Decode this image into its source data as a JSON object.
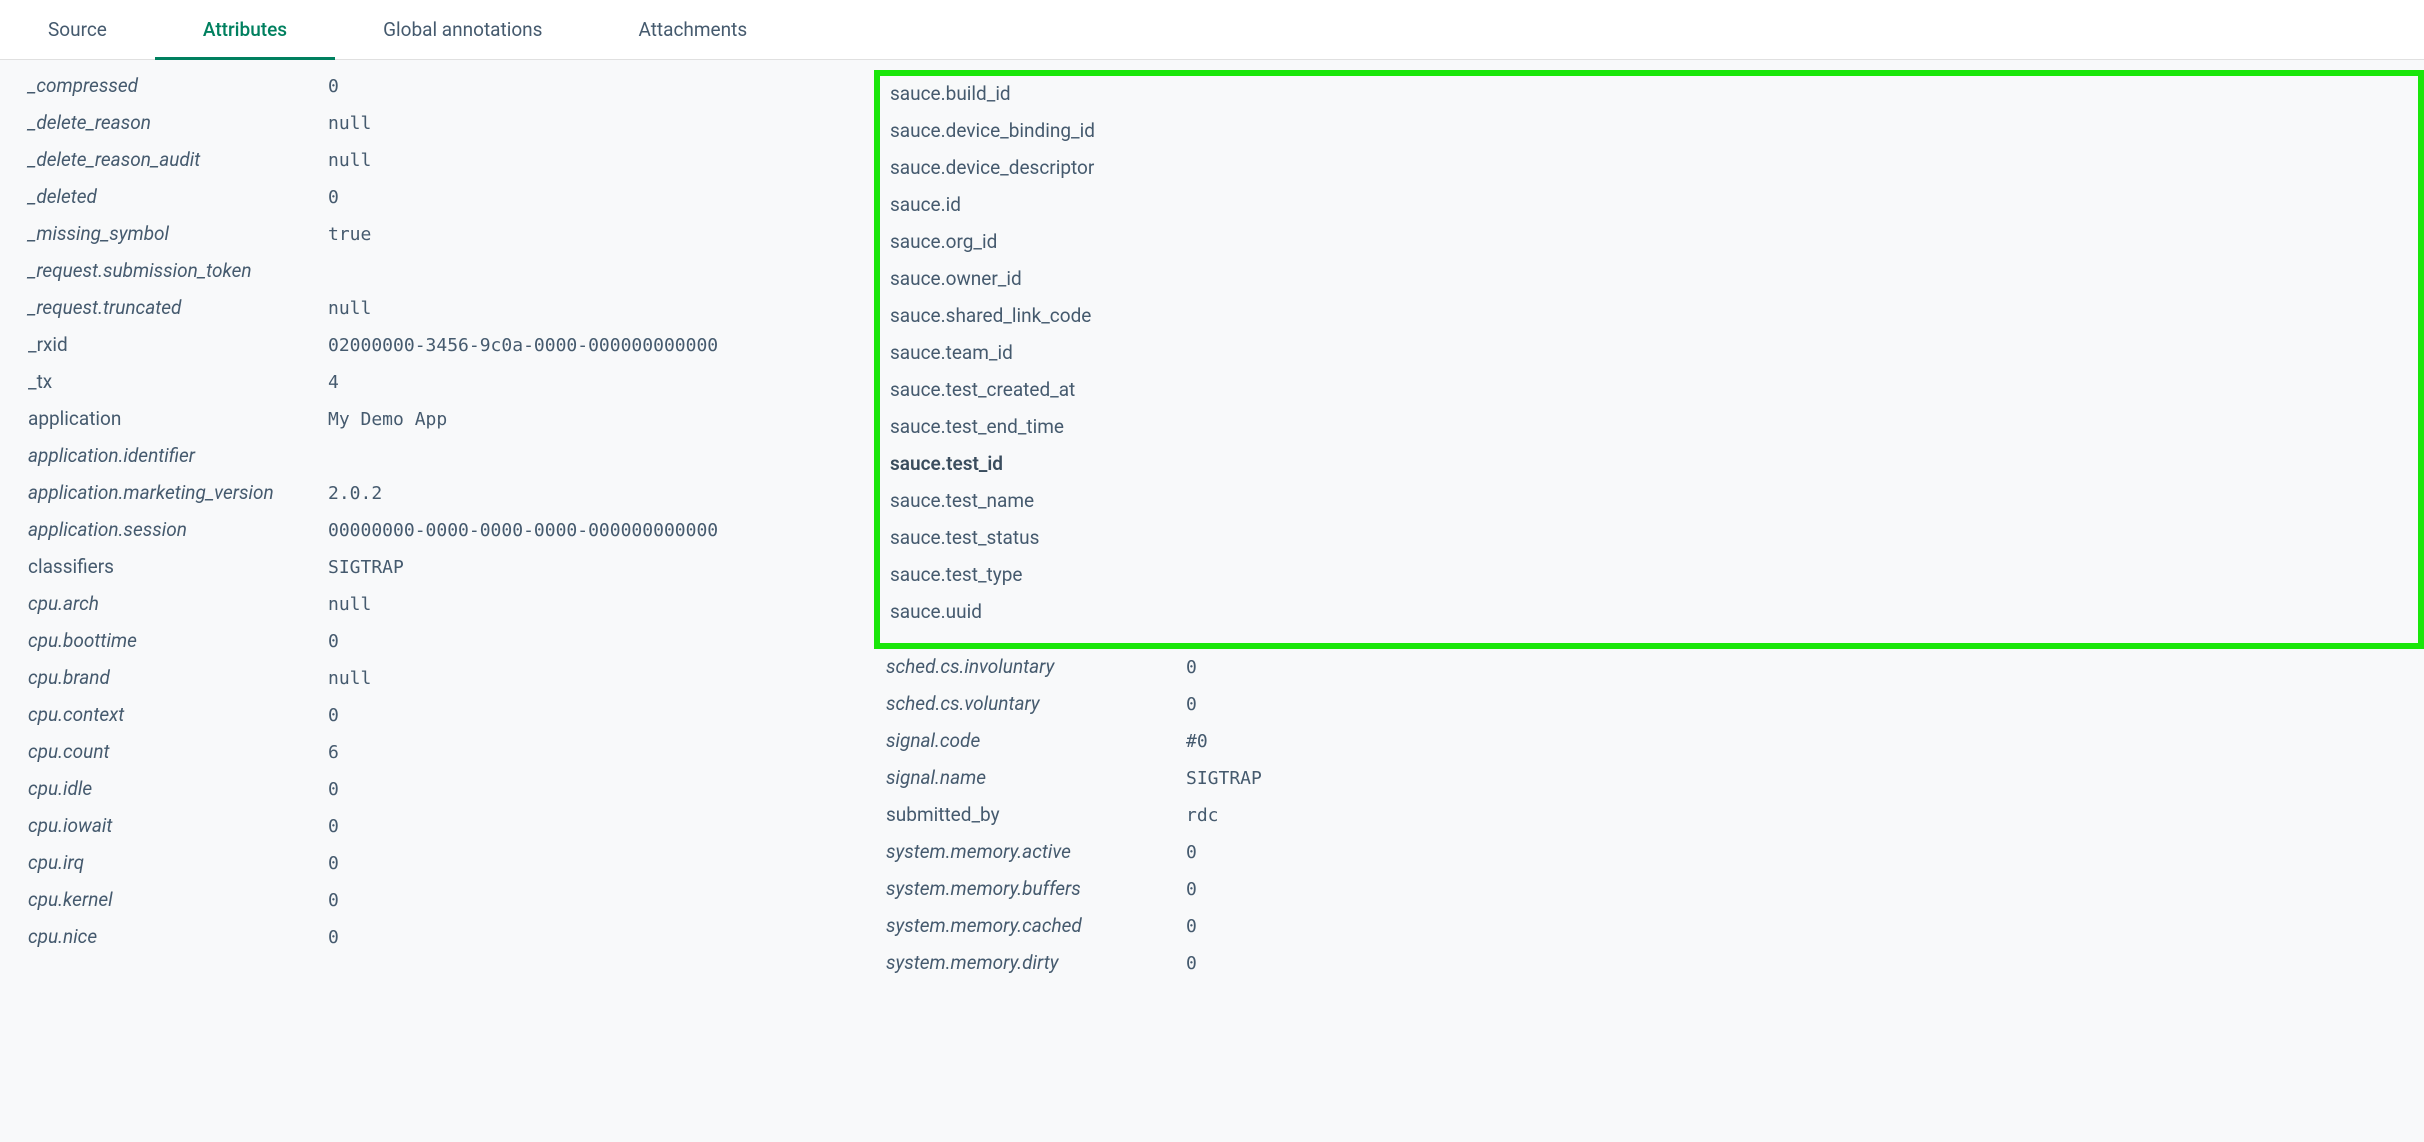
{
  "tabs": [
    {
      "label": "Source",
      "active": false
    },
    {
      "label": "Attributes",
      "active": true
    },
    {
      "label": "Global annotations",
      "active": false
    },
    {
      "label": "Attachments",
      "active": false
    }
  ],
  "left_attrs": [
    {
      "key": "_compressed",
      "value": "0",
      "style": "italic"
    },
    {
      "key": "_delete_reason",
      "value": "null",
      "style": "italic"
    },
    {
      "key": "_delete_reason_audit",
      "value": "null",
      "style": "italic"
    },
    {
      "key": "_deleted",
      "value": "0",
      "style": "italic"
    },
    {
      "key": "_missing_symbol",
      "value": "true",
      "style": "italic"
    },
    {
      "key": "_request.submission_token",
      "value": "",
      "style": "italic"
    },
    {
      "key": "_request.truncated",
      "value": "null",
      "style": "italic"
    },
    {
      "key": "_rxid",
      "value": "02000000-3456-9c0a-0000-000000000000",
      "style": "plain"
    },
    {
      "key": "_tx",
      "value": "4",
      "style": "plain"
    },
    {
      "key": "application",
      "value": "My Demo App",
      "style": "plain"
    },
    {
      "key": "application.identifier",
      "value": "",
      "style": "italic"
    },
    {
      "key": "application.marketing_version",
      "value": "2.0.2",
      "style": "italic"
    },
    {
      "key": "application.session",
      "value": "00000000-0000-0000-0000-000000000000",
      "style": "italic"
    },
    {
      "key": "classifiers",
      "value": "SIGTRAP",
      "style": "plain"
    },
    {
      "key": "cpu.arch",
      "value": "null",
      "style": "italic"
    },
    {
      "key": "cpu.boottime",
      "value": "0",
      "style": "italic"
    },
    {
      "key": "cpu.brand",
      "value": "null",
      "style": "italic"
    },
    {
      "key": "cpu.context",
      "value": "0",
      "style": "italic"
    },
    {
      "key": "cpu.count",
      "value": "6",
      "style": "italic"
    },
    {
      "key": "cpu.idle",
      "value": "0",
      "style": "italic"
    },
    {
      "key": "cpu.iowait",
      "value": "0",
      "style": "italic"
    },
    {
      "key": "cpu.irq",
      "value": "0",
      "style": "italic"
    },
    {
      "key": "cpu.kernel",
      "value": "0",
      "style": "italic"
    },
    {
      "key": "cpu.nice",
      "value": "0",
      "style": "italic"
    }
  ],
  "highlight_attrs": [
    {
      "key": "sauce.build_id",
      "style": "plain"
    },
    {
      "key": "sauce.device_binding_id",
      "style": "plain"
    },
    {
      "key": "sauce.device_descriptor",
      "style": "plain"
    },
    {
      "key": "sauce.id",
      "style": "plain"
    },
    {
      "key": "sauce.org_id",
      "style": "plain"
    },
    {
      "key": "sauce.owner_id",
      "style": "plain"
    },
    {
      "key": "sauce.shared_link_code",
      "style": "plain"
    },
    {
      "key": "sauce.team_id",
      "style": "plain"
    },
    {
      "key": "sauce.test_created_at",
      "style": "plain"
    },
    {
      "key": "sauce.test_end_time",
      "style": "plain"
    },
    {
      "key": "sauce.test_id",
      "style": "bold"
    },
    {
      "key": "sauce.test_name",
      "style": "plain"
    },
    {
      "key": "sauce.test_status",
      "style": "plain"
    },
    {
      "key": "sauce.test_type",
      "style": "plain"
    },
    {
      "key": "sauce.uuid",
      "style": "plain"
    }
  ],
  "right_attrs": [
    {
      "key": "sched.cs.involuntary",
      "value": "0",
      "style": "italic"
    },
    {
      "key": "sched.cs.voluntary",
      "value": "0",
      "style": "italic"
    },
    {
      "key": "signal.code",
      "value": "#0",
      "style": "italic"
    },
    {
      "key": "signal.name",
      "value": "SIGTRAP",
      "style": "italic"
    },
    {
      "key": "submitted_by",
      "value": "rdc",
      "style": "plain"
    },
    {
      "key": "system.memory.active",
      "value": "0",
      "style": "italic"
    },
    {
      "key": "system.memory.buffers",
      "value": "0",
      "style": "italic"
    },
    {
      "key": "system.memory.cached",
      "value": "0",
      "style": "italic"
    },
    {
      "key": "system.memory.dirty",
      "value": "0",
      "style": "italic"
    }
  ]
}
